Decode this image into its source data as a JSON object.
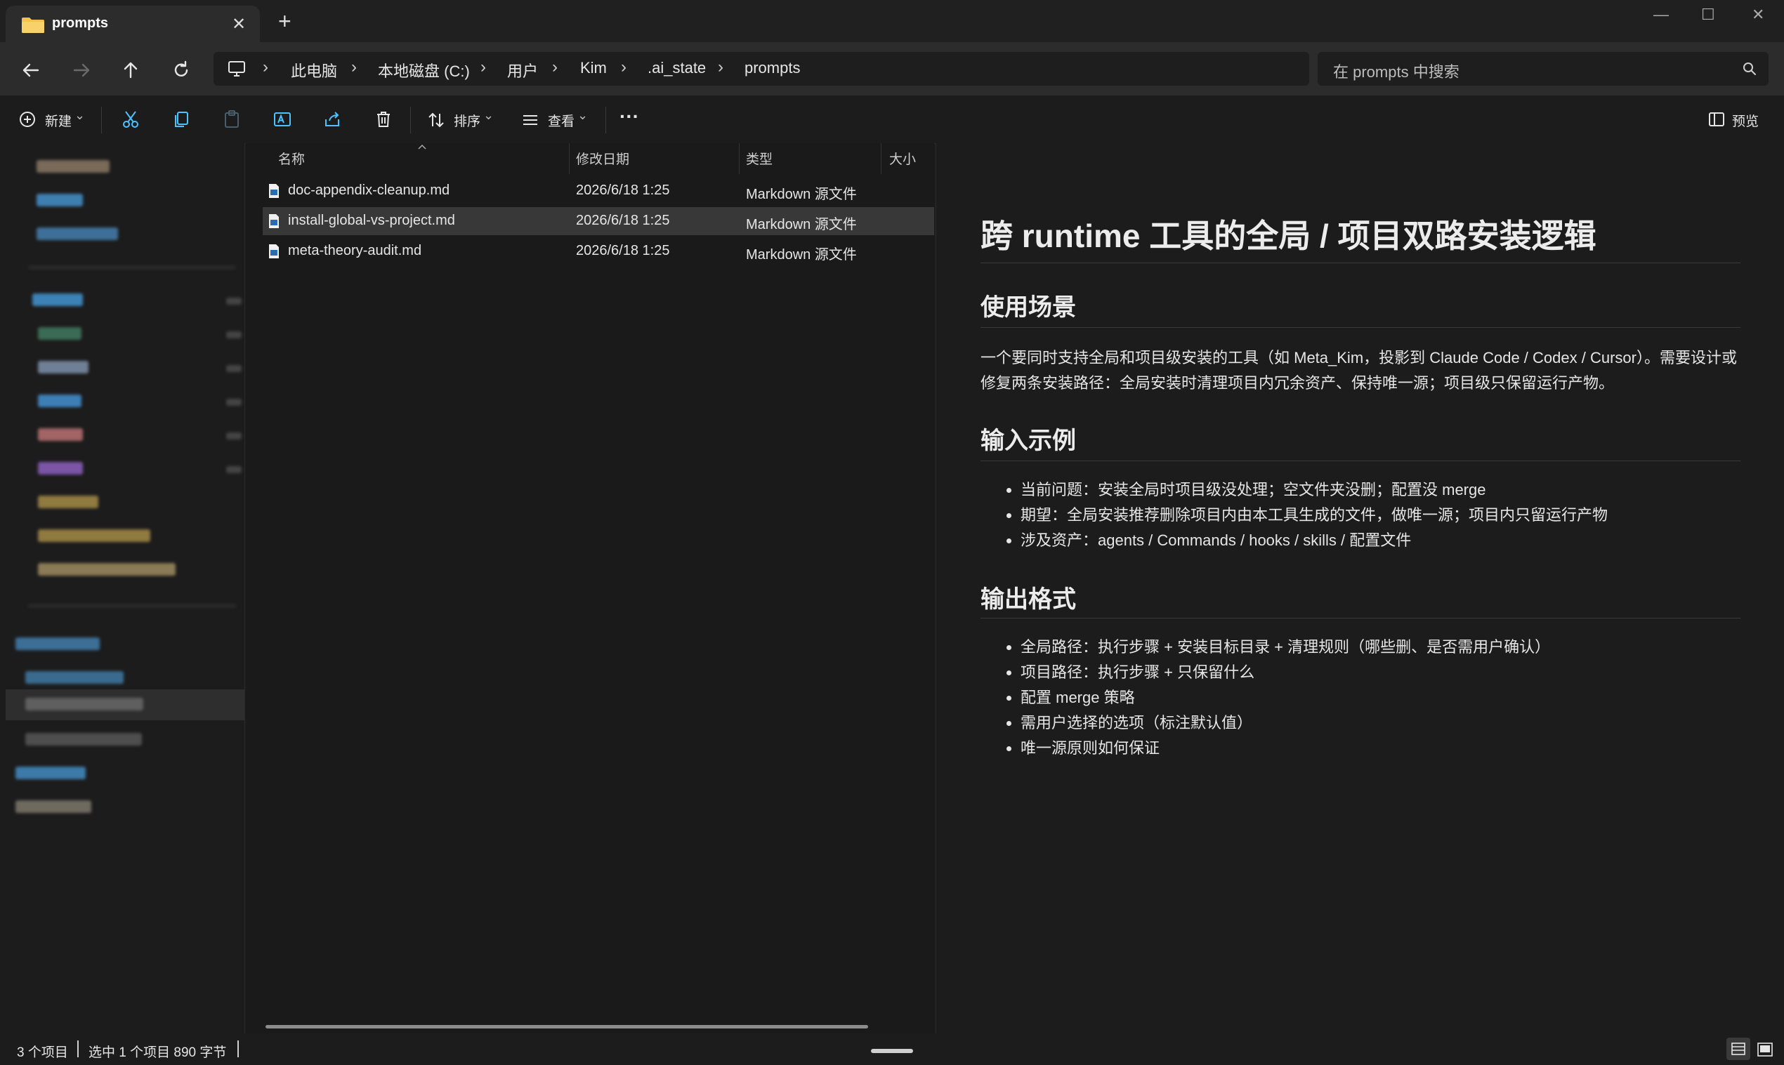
{
  "window": {
    "tab_title": "prompts",
    "tab_close": "✕",
    "new_tab": "+",
    "minimize": "—",
    "maximize": "☐",
    "close": "✕"
  },
  "nav": {
    "breadcrumb": [
      "此电脑",
      "本地磁盘 (C:)",
      "用户",
      "Kim",
      ".ai_state",
      "prompts"
    ],
    "separator": "›",
    "search_placeholder": "在 prompts 中搜索"
  },
  "toolbar": {
    "new_label": "新建",
    "sort_label": "排序",
    "view_label": "查看",
    "more_label": "···",
    "preview_label": "预览",
    "dropdown": "⌄"
  },
  "columns": {
    "name": "名称",
    "modified": "修改日期",
    "type": "类型",
    "size": "大小"
  },
  "files": [
    {
      "name": "doc-appendix-cleanup.md",
      "modified": "2026/6/18 1:25",
      "type": "Markdown 源文件"
    },
    {
      "name": "install-global-vs-project.md",
      "modified": "2026/6/18 1:25",
      "type": "Markdown 源文件",
      "selected": true
    },
    {
      "name": "meta-theory-audit.md",
      "modified": "2026/6/18 1:25",
      "type": "Markdown 源文件"
    }
  ],
  "preview": {
    "title": "跨 runtime 工具的全局 / 项目双路安装逻辑",
    "sections": [
      {
        "heading": "使用场景",
        "paragraph": "一个要同时支持全局和项目级安装的工具（如 Meta_Kim，投影到 Claude Code / Codex / Cursor）。需要设计或修复两条安装路径：全局安装时清理项目内冗余资产、保持唯一源；项目级只保留运行产物。"
      },
      {
        "heading": "输入示例",
        "items": [
          "当前问题：安装全局时项目级没处理；空文件夹没删；配置没 merge",
          "期望：全局安装推荐删除项目内由本工具生成的文件，做唯一源；项目内只留运行产物",
          "涉及资产：agents / Commands / hooks / skills / 配置文件"
        ]
      },
      {
        "heading": "输出格式",
        "items": [
          "全局路径：执行步骤 + 安装目标目录 + 清理规则（哪些删、是否需用户确认）",
          "项目路径：执行步骤 + 只保留什么",
          "配置 merge 策略",
          "需用户选择的选项（标注默认值）",
          "唯一源原则如何保证"
        ]
      }
    ]
  },
  "status": {
    "count": "3 个项目",
    "selection": "选中 1 个项目  890 字节"
  },
  "colors": {
    "accent": "#4cc2ff",
    "folder": "#f2c14e",
    "background": "#1c1c1c"
  }
}
